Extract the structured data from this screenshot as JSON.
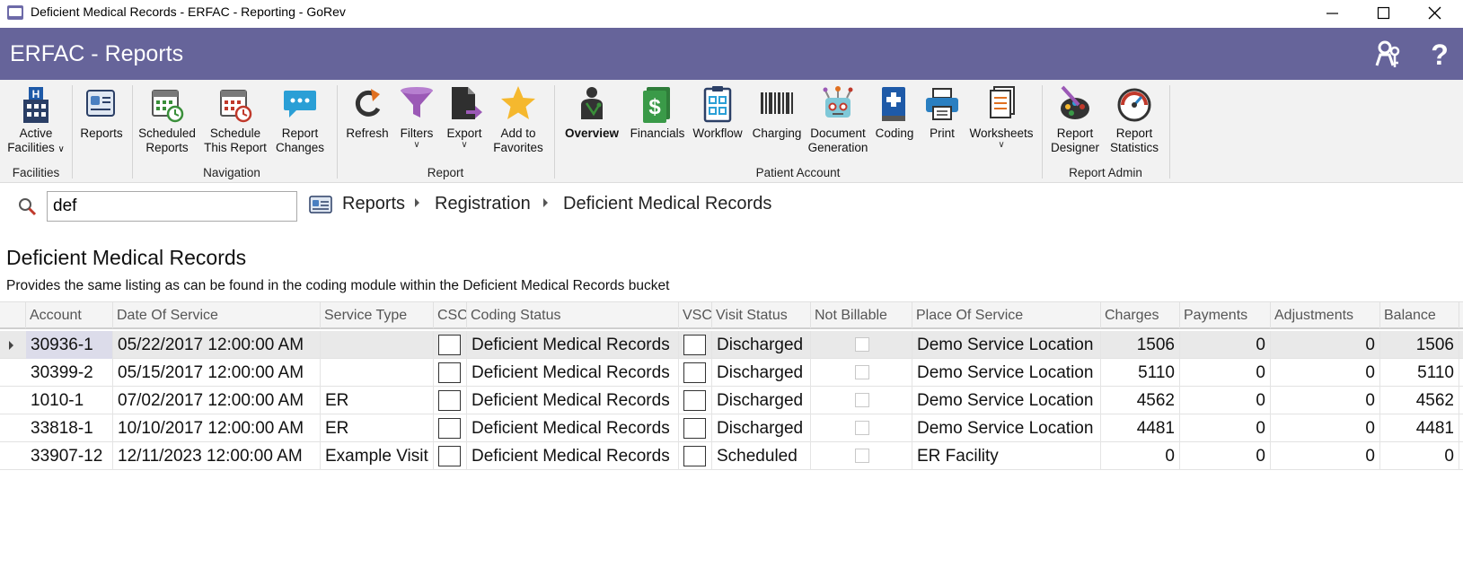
{
  "window": {
    "title": "Deficient Medical Records - ERFAC - Reporting - GoRev"
  },
  "header": {
    "title": "ERFAC - Reports"
  },
  "ribbon": {
    "groups": {
      "facilities": "Facilities",
      "navigation": "Navigation",
      "report": "Report",
      "patient_account": "Patient Account",
      "report_admin": "Report Admin"
    },
    "buttons": {
      "active_facilities": [
        "Active",
        "Facilities"
      ],
      "reports": "Reports",
      "scheduled_reports": [
        "Scheduled",
        "Reports"
      ],
      "schedule_this_report": [
        "Schedule",
        "This Report"
      ],
      "report_changes": [
        "Report",
        "Changes"
      ],
      "refresh": "Refresh",
      "filters": "Filters",
      "export": "Export",
      "add_to_favorites": [
        "Add to",
        "Favorites"
      ],
      "overview": "Overview",
      "financials": "Financials",
      "workflow": "Workflow",
      "charging": "Charging",
      "document_generation": [
        "Document",
        "Generation"
      ],
      "coding": "Coding",
      "print": "Print",
      "worksheets": "Worksheets",
      "report_designer": [
        "Report",
        "Designer"
      ],
      "report_statistics": [
        "Report",
        "Statistics"
      ]
    }
  },
  "search": {
    "value": "def"
  },
  "breadcrumb": [
    "Reports",
    "Registration",
    "Deficient Medical Records"
  ],
  "report": {
    "title": "Deficient Medical Records",
    "description": "Provides the same listing as can be found in the coding module within the Deficient Medical Records bucket"
  },
  "grid": {
    "columns": [
      "Account",
      "Date Of Service",
      "Service Type",
      "CSC",
      "Coding Status",
      "VSC",
      "Visit Status",
      "Not Billable",
      "Place Of Service",
      "Charges",
      "Payments",
      "Adjustments",
      "Balance"
    ],
    "rows": [
      {
        "account": "30936-1",
        "date": "05/22/2017 12:00:00 AM",
        "service_type": "",
        "coding_status": "Deficient Medical Records",
        "visit_status": "Discharged",
        "place": "Demo Service Location",
        "charges": "1506",
        "payments": "0",
        "adjustments": "0",
        "balance": "1506"
      },
      {
        "account": "30399-2",
        "date": "05/15/2017 12:00:00 AM",
        "service_type": "",
        "coding_status": "Deficient Medical Records",
        "visit_status": "Discharged",
        "place": "Demo Service Location",
        "charges": "5110",
        "payments": "0",
        "adjustments": "0",
        "balance": "5110"
      },
      {
        "account": "1010-1",
        "date": "07/02/2017 12:00:00 AM",
        "service_type": "ER",
        "coding_status": "Deficient Medical Records",
        "visit_status": "Discharged",
        "place": "Demo Service Location",
        "charges": "4562",
        "payments": "0",
        "adjustments": "0",
        "balance": "4562"
      },
      {
        "account": "33818-1",
        "date": "10/10/2017 12:00:00 AM",
        "service_type": "ER",
        "coding_status": "Deficient Medical Records",
        "visit_status": "Discharged",
        "place": "Demo Service Location",
        "charges": "4481",
        "payments": "0",
        "adjustments": "0",
        "balance": "4481"
      },
      {
        "account": "33907-12",
        "date": "12/11/2023 12:00:00 AM",
        "service_type": "Example Visit",
        "coding_status": "Deficient Medical Records",
        "visit_status": "Scheduled",
        "place": "ER Facility",
        "charges": "0",
        "payments": "0",
        "adjustments": "0",
        "balance": "0"
      }
    ]
  },
  "colors": {
    "header_bg": "#66649a",
    "ribbon_bg": "#f2f2f2",
    "selected_row": "#e9e9e9"
  }
}
